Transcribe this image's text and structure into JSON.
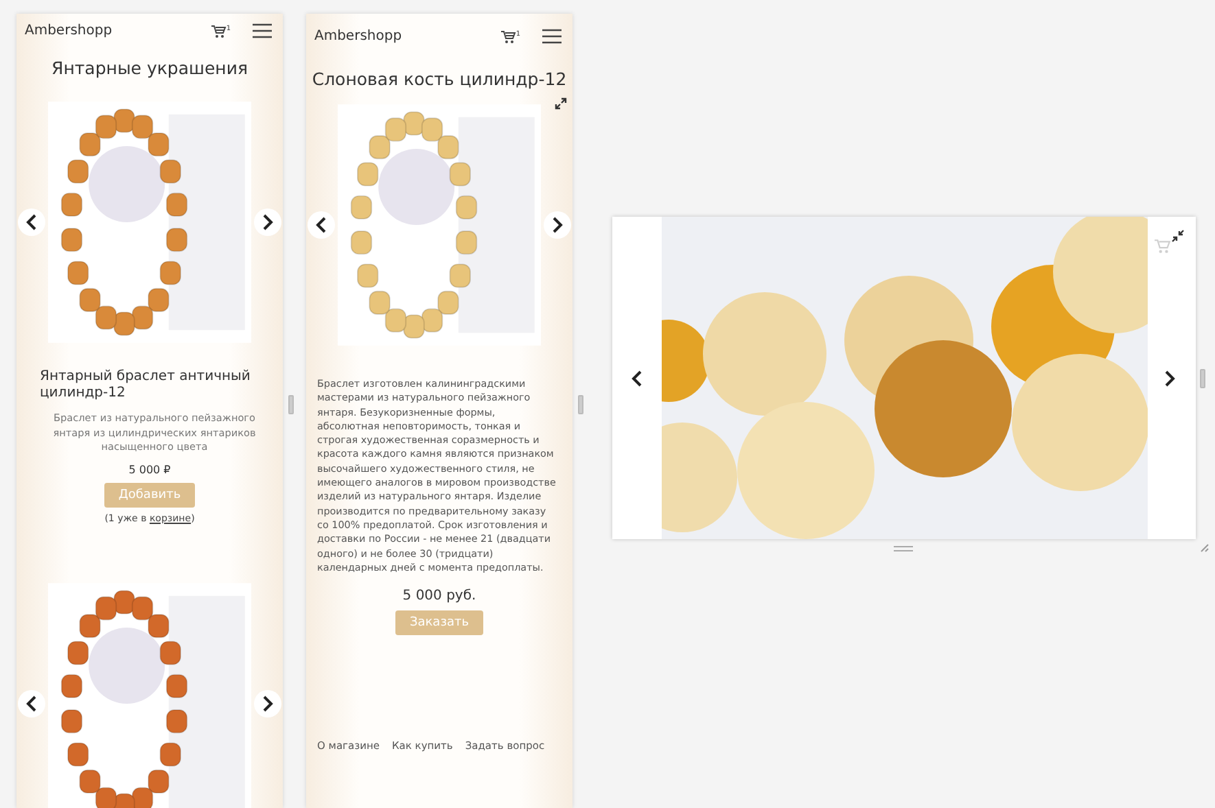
{
  "catalog_panel": {
    "brand": "Ambershopp",
    "cart_count": "1",
    "title": "Янтарные украшения",
    "products": [
      {
        "kind": "full",
        "name": "Янтарный браслет античный цилиндр-12",
        "description": "Браслет из натурального пейзажного янтаря из цилиндрических янтариков насыщенного цвета",
        "price": "5 000 ₽",
        "button": "Добавить",
        "note_prefix": "(1 уже в ",
        "note_link": "корзине",
        "note_suffix": ")"
      },
      {
        "kind": "image_only"
      }
    ]
  },
  "product_panel": {
    "brand": "Ambershopp",
    "cart_count": "1",
    "title": "Слоновая кость цилиндр-12",
    "description": "Браслет  изготовлен калининградскими мастерами из натурального пейзажного янтаря. Безукоризненные формы, абсолютная неповторимость, тонкая и строгая художественная соразмерность и красота каждого камня являются признаком высочайшего художественного стиля, не имеющего аналогов в мировом производстве изделий из натурального янтаря. Изделие производится по предварительному заказу со 100% предоплатой. Срок изготовления и доставки по  России - не менее 21 (двадцати одного) и не более 30 (тридцати) календарных дней с момента предоплаты.",
    "price": "5 000 руб.",
    "button": "Заказать",
    "footer_links": [
      "О магазине",
      "Как купить",
      "Задать вопрос"
    ]
  }
}
